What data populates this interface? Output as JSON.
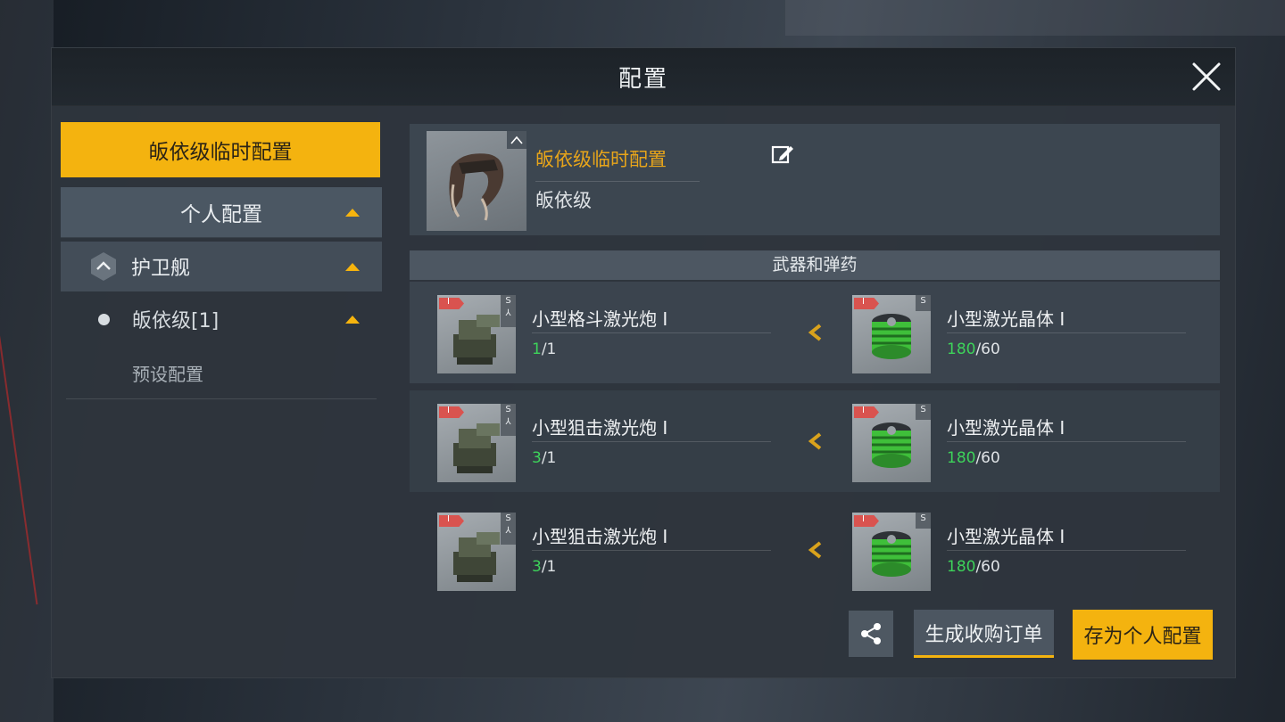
{
  "window": {
    "title": "配置"
  },
  "left": {
    "temp_config_label": "皈依级临时配置",
    "personal_group_label": "个人配置",
    "ship_class_label": "护卫舰",
    "ship_item_label": "皈依级[1]",
    "preset_label": "预设配置"
  },
  "header": {
    "config_name": "皈依级临时配置",
    "ship_name": "皈依级"
  },
  "section": {
    "weapons_title": "武器和弹药"
  },
  "slots": [
    {
      "weapon": {
        "name": "小型格斗激光炮 I",
        "count_have": "1",
        "count_sep": "/1",
        "flag": "I",
        "tag": "S"
      },
      "ammo": {
        "name": "小型激光晶体 I",
        "count_have": "180",
        "count_sep": "/60",
        "flag": "I",
        "tag": "S"
      }
    },
    {
      "weapon": {
        "name": "小型狙击激光炮 I",
        "count_have": "3",
        "count_sep": "/1",
        "flag": "I",
        "tag": "S"
      },
      "ammo": {
        "name": "小型激光晶体 I",
        "count_have": "180",
        "count_sep": "/60",
        "flag": "I",
        "tag": "S"
      }
    },
    {
      "weapon": {
        "name": "小型狙击激光炮 I",
        "count_have": "3",
        "count_sep": "/1",
        "flag": "I",
        "tag": "S"
      },
      "ammo": {
        "name": "小型激光晶体 I",
        "count_have": "180",
        "count_sep": "/60",
        "flag": "I",
        "tag": "S"
      }
    }
  ],
  "actions": {
    "order_label": "生成收购订单",
    "save_label": "存为个人配置"
  },
  "icons": {
    "close": "close-icon",
    "edit": "edit-icon",
    "share": "share-icon",
    "collapse": "chevron-up-icon",
    "expand_toggle": "triangle-up-icon",
    "transfer": "chevron-left-icon"
  },
  "colors": {
    "accent": "#f4b30f",
    "config_name": "#e8a51a",
    "count_ok": "#3dd35a",
    "panel": "#2e353d"
  }
}
